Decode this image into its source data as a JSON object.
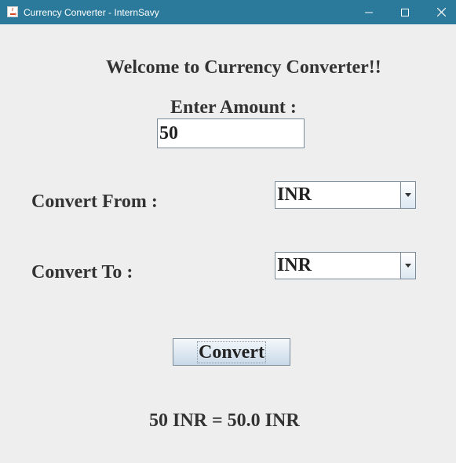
{
  "window": {
    "title": "Currency Converter - InternSavy",
    "controls": [
      "minimize-icon",
      "maximize-icon",
      "close-icon"
    ]
  },
  "app": {
    "welcome": "Welcome to Currency Converter!!",
    "amount_label": "Enter Amount :",
    "amount_value": "50",
    "from_label": "Convert From :",
    "from_value": "INR",
    "to_label": "Convert To :",
    "to_value": "INR",
    "convert_label": "Convert",
    "result": "50 INR = 50.0 INR"
  },
  "colors": {
    "titlebar": "#2b7a9b",
    "background": "#eeeeee"
  }
}
